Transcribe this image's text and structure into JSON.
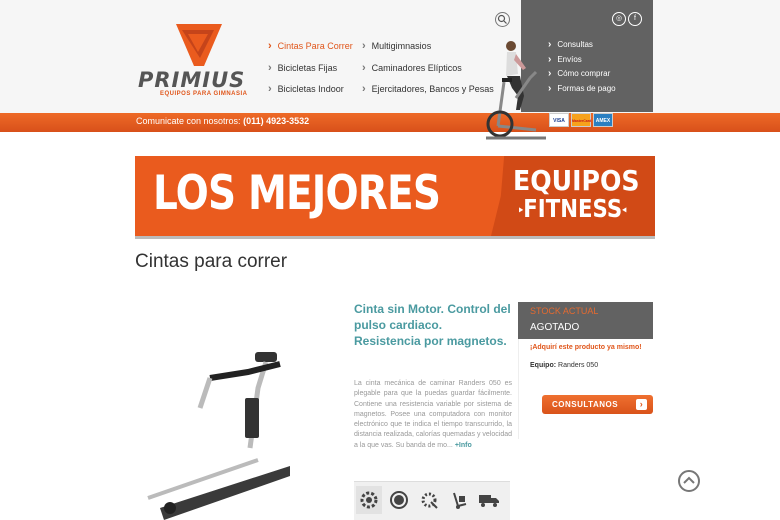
{
  "brand": {
    "name": "PRIMIUS",
    "tagline": "EQUIPOS PARA GIMNASIA"
  },
  "nav": {
    "col1": [
      "Cintas Para Correr",
      "Bicicletas Fijas",
      "Bicicletas Indoor"
    ],
    "col2": [
      "Multigimnasios",
      "Caminadores Elípticos",
      "Ejercitadores, Bancos y Pesas"
    ],
    "active": "Cintas Para Correr"
  },
  "side_menu": [
    "Consultas",
    "Envíos",
    "Cómo comprar",
    "Formas de pago"
  ],
  "contact": {
    "label": "Comunicate con nosotros:",
    "phone": "(011) 4923-3532"
  },
  "payment_cards": [
    "VISA",
    "MasterCard",
    "AMEX"
  ],
  "banner": {
    "left": "LOS MEJORES",
    "right_line1": "EQUIPOS",
    "right_line2": "FITNESS"
  },
  "page_title": "Cintas para correr",
  "product": {
    "title": "Cinta sin Motor. Control del pulso cardiaco. Resistencia por magnetos.",
    "description": "La cinta mecánica de caminar Randers 050 es plegable para que la puedas guardar fácilmente. Contiene una resistencia variable por sistema de magnetos. Posee una computadora con monitor electrónico que te indica el tiempo transcurrido, la distancia realizada, calorías quemadas y velocidad a la que vas. Su banda de mo...",
    "more": "+Info",
    "feature_icons": [
      "gear-icon",
      "quality-badge-icon",
      "settings-icon",
      "hand-truck-icon",
      "delivery-truck-icon"
    ]
  },
  "stock": {
    "label": "STOCK ACTUAL",
    "status": "AGOTADO",
    "link": "¡Adquirí este producto ya mismo!",
    "equipo_label": "Equipo:",
    "equipo_value": "Randers 050",
    "button": "CONSULTANOS"
  },
  "colors": {
    "accent": "#ea5b1e",
    "dark": "#626262",
    "teal": "#4a9aa0"
  }
}
